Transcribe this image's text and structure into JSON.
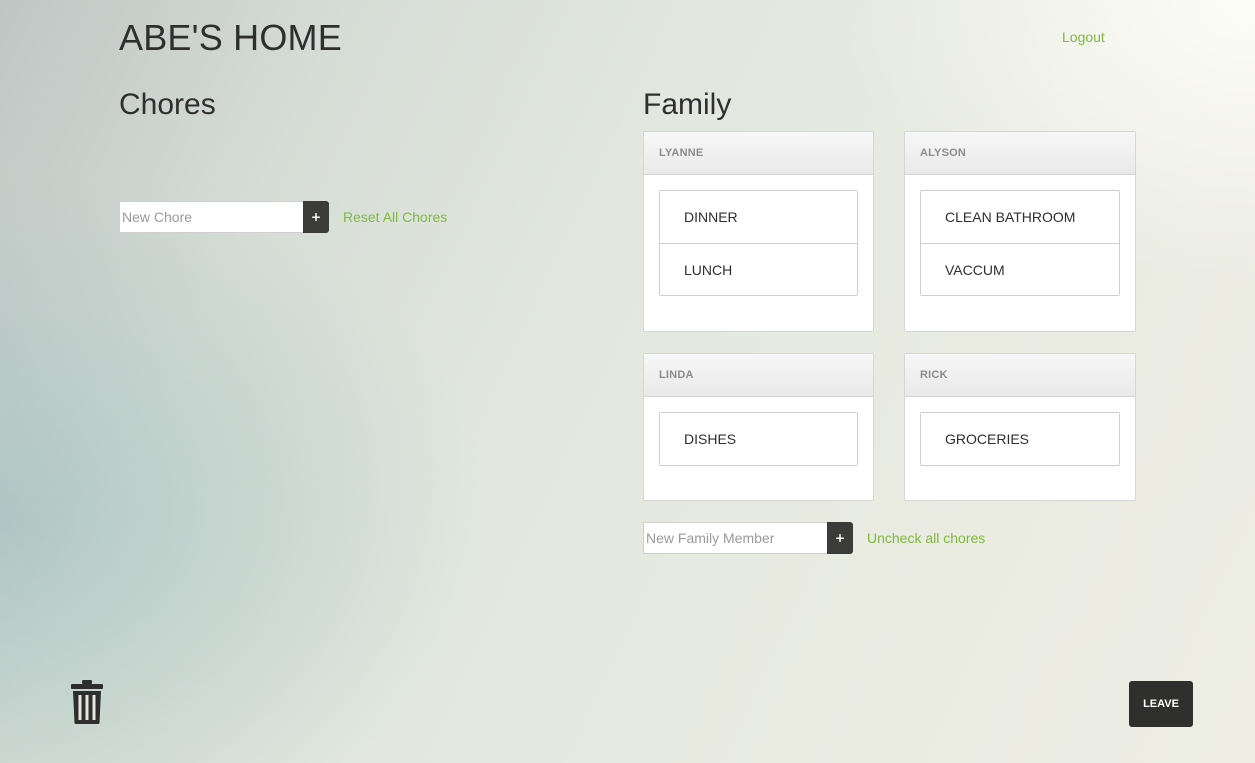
{
  "header": {
    "title": "ABE'S HOME",
    "logout_label": "Logout"
  },
  "chores": {
    "heading": "Chores",
    "input_placeholder": "New Chore",
    "add_symbol": "+",
    "reset_label": "Reset All Chores"
  },
  "family": {
    "heading": "Family",
    "members": [
      {
        "name": "LYANNE",
        "chores": [
          "DINNER",
          "LUNCH"
        ]
      },
      {
        "name": "ALYSON",
        "chores": [
          "CLEAN BATHROOM",
          "VACCUM"
        ]
      },
      {
        "name": "LINDA",
        "chores": [
          "DISHES"
        ]
      },
      {
        "name": "RICK",
        "chores": [
          "GROCERIES"
        ]
      }
    ],
    "input_placeholder": "New Family Member",
    "add_symbol": "+",
    "uncheck_label": "Uncheck all chores"
  },
  "footer": {
    "trash_icon": "trash-icon",
    "leave_label": "LEAVE"
  },
  "colors": {
    "accent": "#7dbb3f",
    "dark_button": "#2f2f2d"
  }
}
